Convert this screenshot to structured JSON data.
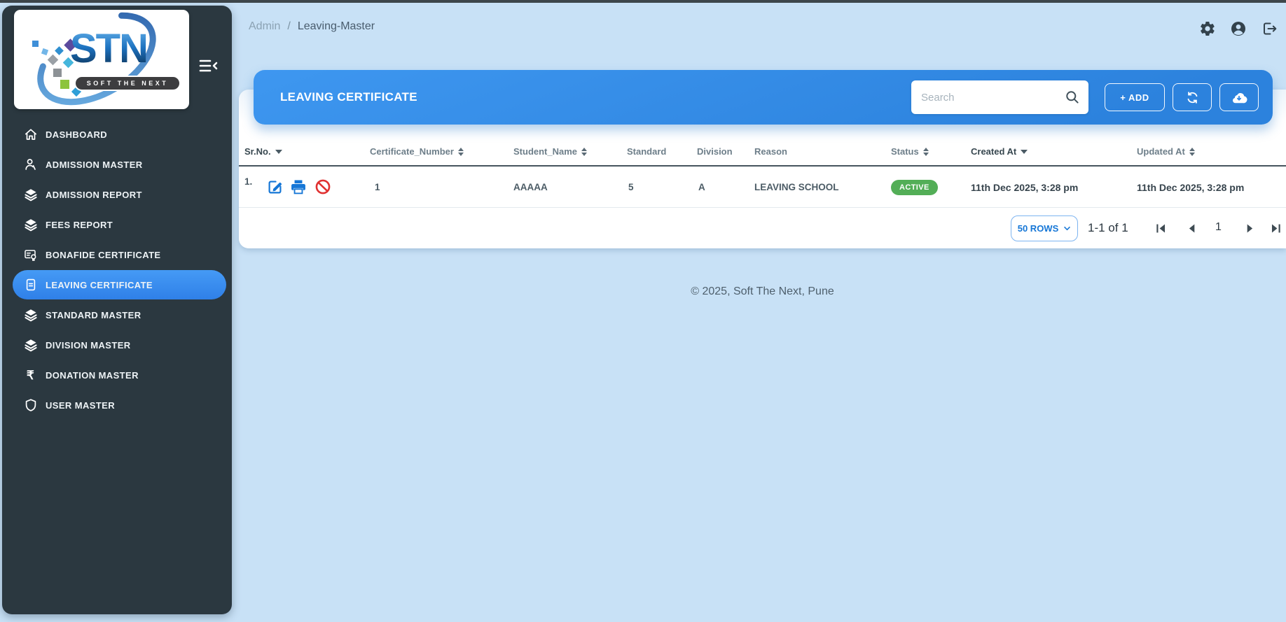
{
  "breadcrumb": {
    "section": "Admin",
    "separator": "/",
    "page": "Leaving-Master"
  },
  "topbar": {
    "icons": [
      "gear-icon",
      "account-icon",
      "logout-icon"
    ]
  },
  "sidebar": {
    "logo": {
      "text": "STN",
      "tagline": "SOFT THE NEXT"
    },
    "collapse_icon": "menu-collapse-icon",
    "items": [
      {
        "label": "DASHBOARD",
        "icon": "home-icon",
        "active": false
      },
      {
        "label": "ADMISSION MASTER",
        "icon": "person-icon",
        "active": false
      },
      {
        "label": "ADMISSION REPORT",
        "icon": "layers-icon",
        "active": false
      },
      {
        "label": "FEES REPORT",
        "icon": "layers-icon",
        "active": false
      },
      {
        "label": "BONAFIDE CERTIFICATE",
        "icon": "certificate-icon",
        "active": false
      },
      {
        "label": "LEAVING CERTIFICATE",
        "icon": "document-icon",
        "active": true
      },
      {
        "label": "STANDARD MASTER",
        "icon": "layers-icon",
        "active": false
      },
      {
        "label": "DIVISION MASTER",
        "icon": "layers-icon",
        "active": false
      },
      {
        "label": "DONATION MASTER",
        "icon": "rupee-icon",
        "active": false
      },
      {
        "label": "USER MASTER",
        "icon": "shield-icon",
        "active": false
      }
    ]
  },
  "header": {
    "title": "LEAVING CERTIFICATE",
    "search_placeholder": "Search",
    "search_value": "",
    "add_label": "+ ADD",
    "action_icons": [
      "refresh-icon",
      "cloud-download-icon"
    ]
  },
  "table": {
    "columns": [
      {
        "label": "Sr.No.",
        "sort": "desc"
      },
      {
        "label": "Certificate_Number",
        "sort": "both"
      },
      {
        "label": "Student_Name",
        "sort": "both"
      },
      {
        "label": "Standard",
        "sort": "none"
      },
      {
        "label": "Division",
        "sort": "none"
      },
      {
        "label": "Reason",
        "sort": "none"
      },
      {
        "label": "Status",
        "sort": "both"
      },
      {
        "label": "Created At",
        "sort": "desc"
      },
      {
        "label": "Updated At",
        "sort": "both"
      }
    ],
    "rows": [
      {
        "sr": "1.",
        "actions": [
          "edit-icon",
          "print-icon",
          "block-icon"
        ],
        "certificate_number": "1",
        "student_name": "AAAAA",
        "standard": "5",
        "division": "A",
        "reason": "LEAVING SCHOOL",
        "status": "ACTIVE",
        "created_at": "11th Dec 2025, 3:28 pm",
        "updated_at": "11th Dec 2025, 3:28 pm"
      }
    ]
  },
  "pagination": {
    "rows_per_page": "50 ROWS",
    "range": "1-1 of 1",
    "page": "1"
  },
  "footer": {
    "copyright": "© 2025, Soft The Next, Pune"
  },
  "colors": {
    "accent_blue": "#2f87e6",
    "status_active_green": "#53ae57",
    "danger_red": "#e03131",
    "link_blue": "#1576d6",
    "sidebar_dark": "#2b3840"
  }
}
